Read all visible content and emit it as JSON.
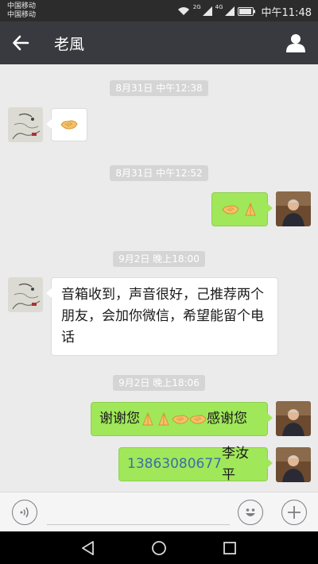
{
  "status_bar": {
    "carrier_1": "中国移动",
    "carrier_2": "中国移动",
    "network_1": "2G",
    "network_2": "4G",
    "time": "中午11:48",
    "icons": [
      "wifi-icon",
      "signal-icon",
      "signal-icon",
      "battery-icon"
    ]
  },
  "header": {
    "title": "老風",
    "back_icon": "arrow-left-icon",
    "profile_icon": "person-icon"
  },
  "messages": [
    {
      "type": "timestamp",
      "text": "8月31日 中午12:38"
    },
    {
      "type": "message",
      "side": "in",
      "sender_avatar": "ink-painting-avatar",
      "emoji": [
        "handshake-emoji"
      ]
    },
    {
      "type": "timestamp",
      "text": "8月31日 中午12:52"
    },
    {
      "type": "message",
      "side": "out",
      "sender_avatar": "man-photo-avatar",
      "emoji": [
        "handshake-emoji",
        "praying-hands-emoji"
      ]
    },
    {
      "type": "timestamp",
      "text": "9月2日 晚上18:00"
    },
    {
      "type": "message",
      "side": "in",
      "sender_avatar": "ink-painting-avatar",
      "text": "音箱收到，声音很好，己推荐两个朋友，会加你微信，希望能留个电话"
    },
    {
      "type": "timestamp",
      "text": "9月2日 晚上18:06"
    },
    {
      "type": "message",
      "side": "out",
      "sender_avatar": "man-photo-avatar",
      "text_before": "谢谢您",
      "emoji": [
        "praying-hands-emoji",
        "praying-hands-emoji",
        "handshake-emoji",
        "handshake-emoji"
      ],
      "text_after": "感谢您"
    },
    {
      "type": "message",
      "side": "out",
      "sender_avatar": "man-photo-avatar",
      "phone": "13863080677",
      "text": "李汝平"
    }
  ],
  "input_bar": {
    "voice_icon": "voice-icon",
    "text_value": "",
    "emoji_icon": "smiley-icon",
    "more_icon": "plus-icon"
  },
  "nav_bar": {
    "icons": [
      "back-triangle-icon",
      "home-circle-icon",
      "recents-square-icon"
    ]
  },
  "colors": {
    "chat_background": "#ebebeb",
    "header_background": "#393a3f",
    "outgoing_bubble": "#a0e75a",
    "incoming_bubble": "#ffffff",
    "phone_link": "#3a6fa6"
  }
}
